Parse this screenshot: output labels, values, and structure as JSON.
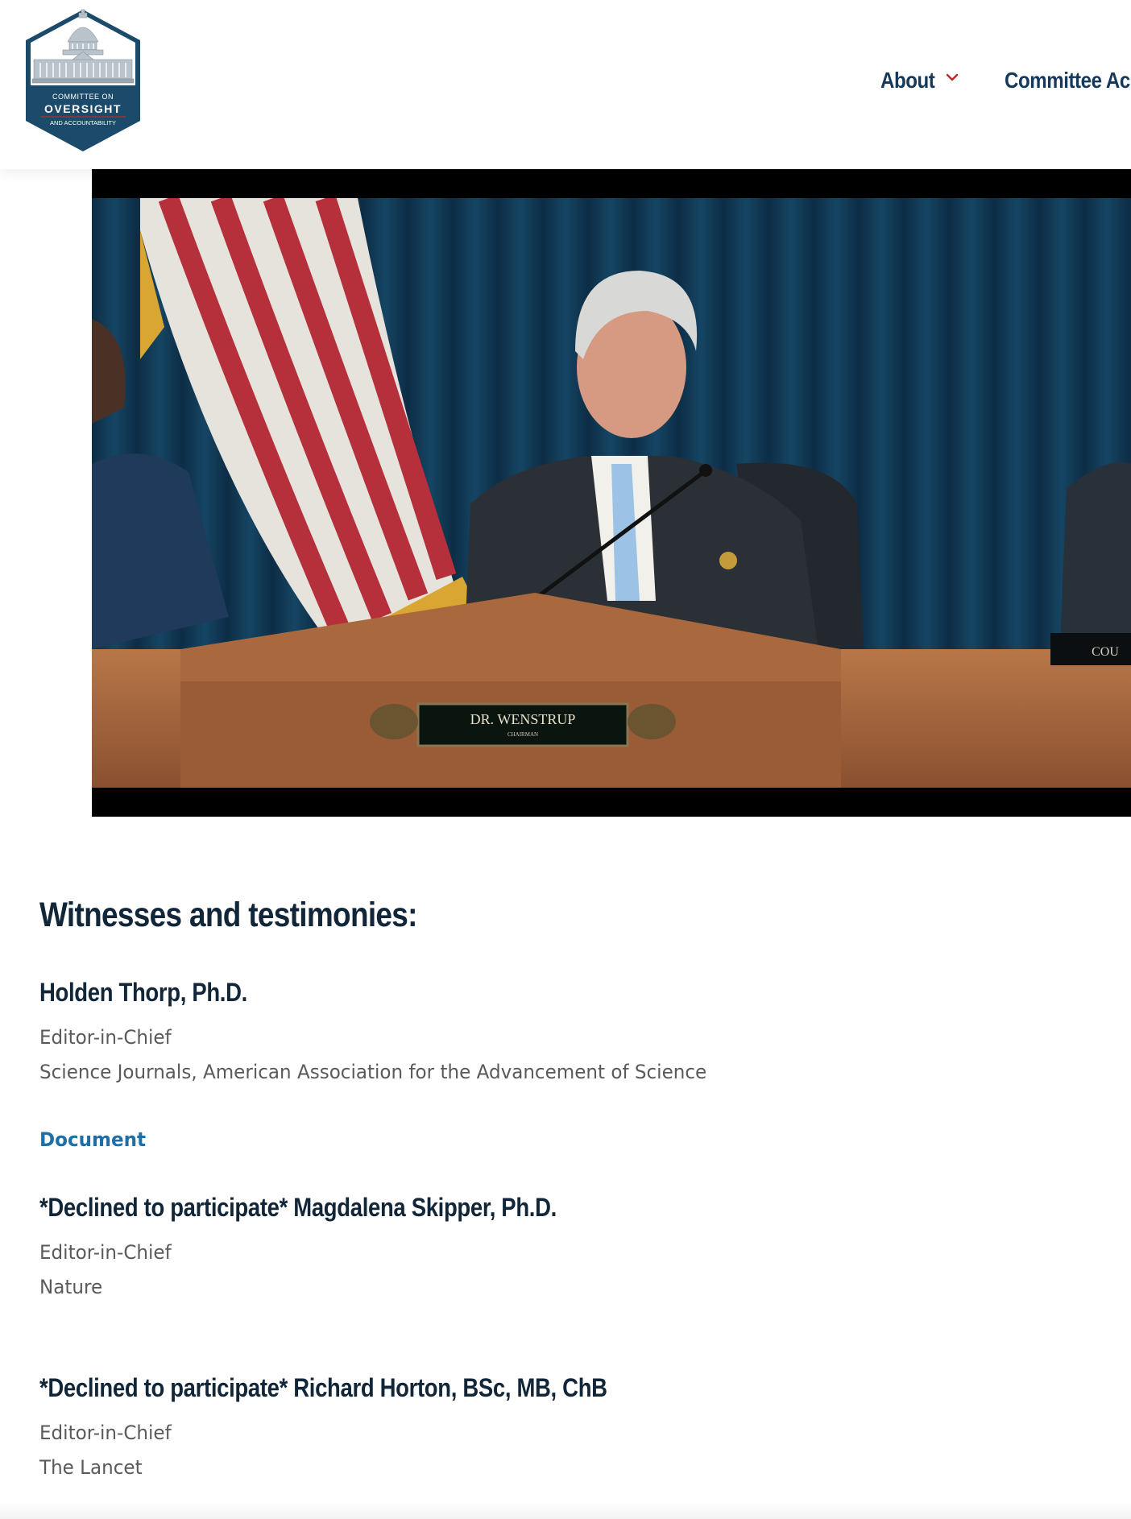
{
  "header": {
    "logo": {
      "line1": "COMMITTEE ON",
      "line2": "OVERSIGHT",
      "line3": "AND ACCOUNTABILITY",
      "icon": "capitol-dome-icon",
      "color": "#1b4a6b"
    },
    "nav": [
      {
        "label": "About",
        "has_dropdown": true
      },
      {
        "label": "Committee Ac"
      }
    ]
  },
  "video": {
    "nameplate_main": "DR. WENSTRUP",
    "nameplate_sub": "CHAIRMAN",
    "right_nameplate": "COU"
  },
  "witnesses": {
    "title": "Witnesses and testimonies:",
    "items": [
      {
        "name": "Holden Thorp, Ph.D.",
        "role": "Editor-in-Chief",
        "org": "Science Journals, American Association for the Advancement of Science",
        "link": "Document"
      },
      {
        "name": "*Declined to participate* Magdalena Skipper, Ph.D.",
        "role": "Editor-in-Chief",
        "org": "Nature"
      },
      {
        "name": "*Declined to participate* Richard Horton, BSc, MB, ChB",
        "role": "Editor-in-Chief",
        "org": "The Lancet"
      }
    ]
  },
  "colors": {
    "nav_text": "#15385b",
    "chevron": "#c0272d",
    "link": "#1e6fa5",
    "heading": "#12263a",
    "body_text": "#5a5a5a"
  }
}
